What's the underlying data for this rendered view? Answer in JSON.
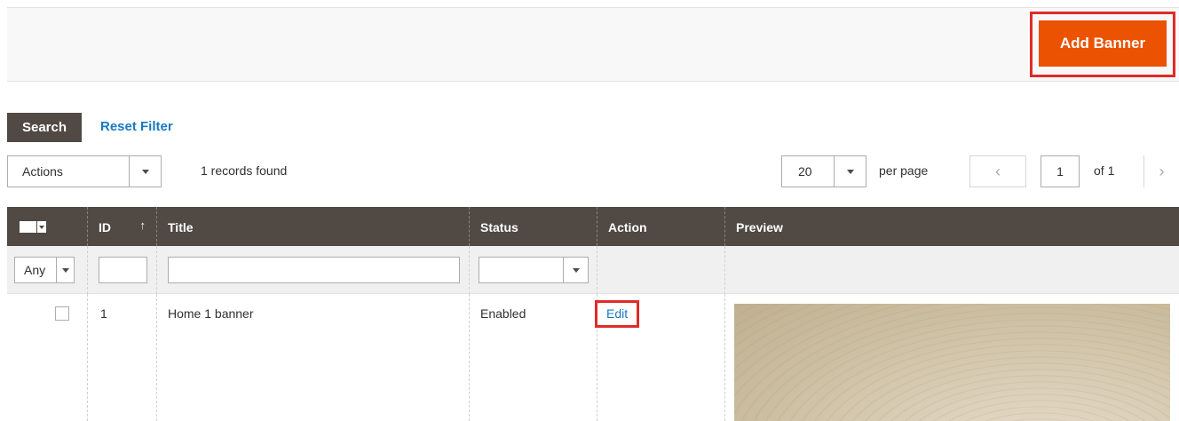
{
  "header": {
    "add_banner_label": "Add Banner"
  },
  "toolbar": {
    "search_label": "Search",
    "reset_filter_label": "Reset Filter",
    "actions_label": "Actions",
    "records_found": "1 records found",
    "per_page_value": "20",
    "per_page_label": "per page",
    "prev_icon": "‹",
    "next_icon": "›",
    "current_page": "1",
    "of_pages": "of 1"
  },
  "grid": {
    "columns": [
      {
        "key": "select",
        "label": ""
      },
      {
        "key": "id",
        "label": "ID"
      },
      {
        "key": "title",
        "label": "Title"
      },
      {
        "key": "status",
        "label": "Status"
      },
      {
        "key": "action",
        "label": "Action"
      },
      {
        "key": "preview",
        "label": "Preview"
      }
    ],
    "sort_icon": "↑",
    "filters": {
      "select_any": "Any",
      "id": "",
      "title": "",
      "status": ""
    },
    "rows": [
      {
        "id": "1",
        "title": "Home 1 banner",
        "status": "Enabled",
        "action": "Edit"
      }
    ]
  },
  "colors": {
    "accent": "#eb5202",
    "header_bg": "#514943",
    "link": "#1979c3",
    "highlight": "#e02b27"
  }
}
